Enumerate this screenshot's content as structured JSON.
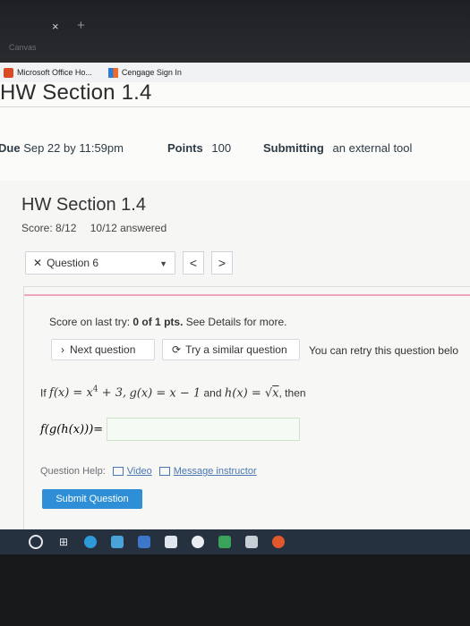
{
  "browser": {
    "tab_new_symbol": "+",
    "tab_close_symbol": "×",
    "faint_label": "Canvas",
    "bookmarks": [
      {
        "label": "Microsoft Office Ho...",
        "icon": "microsoft-office-icon"
      },
      {
        "label": "Cengage Sign In",
        "icon": "cengage-icon"
      }
    ]
  },
  "page": {
    "title": "HW Section 1.4",
    "due_label": "Due",
    "due_value": "Sep 22 by 11:59pm",
    "points_label": "Points",
    "points_value": "100",
    "submitting_label": "Submitting",
    "submitting_value": "an external tool"
  },
  "homework": {
    "title": "HW Section 1.4",
    "score": "Score: 8/12",
    "answered": "10/12 answered",
    "question_select": "Question 6",
    "prev_label": "<",
    "next_label": ">"
  },
  "question": {
    "last_try_prefix": "Score on last try:",
    "last_try_score": "0 of 1 pts.",
    "last_try_suffix": "See Details for more.",
    "next_question": "Next question",
    "similar_question": "Try a similar question",
    "retry_text": "You can retry this question belo",
    "prompt_if": "If",
    "prompt_and": "and",
    "prompt_then": ", then",
    "f_def": "f(x) = x",
    "f_exp": "4",
    "f_rest": " + 3,",
    "g_def": " g(x) = x − 1",
    "h_def": " h(x) = √",
    "h_arg": "x",
    "answer_label": "f(g(h(x)))=",
    "answer_value": "",
    "help_label": "Question Help:",
    "video_label": "Video",
    "message_label": "Message instructor",
    "submit_label": "Submit Question"
  },
  "colors": {
    "accent": "#2e8fd6",
    "pink_rule": "#f0a6b8",
    "taskbar": "#263140"
  }
}
